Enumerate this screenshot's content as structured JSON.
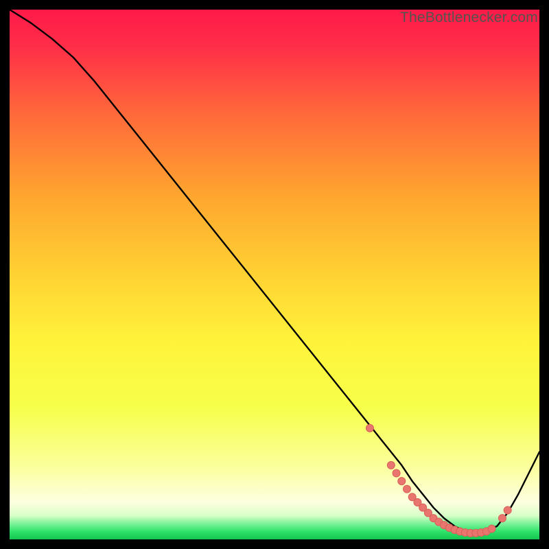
{
  "watermark": "TheBottlenecker.com",
  "colors": {
    "bg_black": "#000000",
    "line": "#000000",
    "dot_fill": "#e8766f",
    "dot_stroke": "#d85f58",
    "grad_top": "#ff1a49",
    "grad_mid_upper": "#ff8a2a",
    "grad_mid": "#ffde33",
    "grad_lower": "#f6ff4a",
    "grad_pale": "#fdffd8",
    "grad_green": "#2fe36a",
    "grad_green2": "#13c64f"
  },
  "chart_data": {
    "type": "line",
    "title": "",
    "xlabel": "",
    "ylabel": "",
    "xlim": [
      0,
      100
    ],
    "ylim": [
      0,
      100
    ],
    "series": [
      {
        "name": "bottleneck-curve",
        "x": [
          0,
          4,
          8,
          12,
          16,
          20,
          24,
          28,
          32,
          36,
          40,
          44,
          48,
          52,
          56,
          60,
          64,
          68,
          70,
          72,
          74,
          76,
          78,
          80,
          82,
          84,
          86,
          88,
          90,
          92,
          94,
          96,
          98,
          100
        ],
        "y": [
          100,
          97.5,
          94.5,
          91,
          86.5,
          81.5,
          76.5,
          71.5,
          66.5,
          61.5,
          56.5,
          51.5,
          46.5,
          41.5,
          36.5,
          31.5,
          26.5,
          21.5,
          19,
          16.5,
          14,
          11,
          8.5,
          6,
          4,
          2.5,
          1.5,
          1.2,
          1.5,
          2.5,
          5,
          8.5,
          12.5,
          16.5
        ]
      }
    ],
    "flat_region_dots": {
      "x": [
        68,
        72,
        73,
        74,
        75,
        76,
        77,
        78,
        79,
        80,
        81,
        82,
        83,
        84,
        85,
        86,
        87,
        88,
        89,
        90,
        91,
        93,
        94
      ],
      "y": [
        21,
        14,
        12.5,
        11,
        9.5,
        8,
        7,
        6,
        5,
        4,
        3.3,
        2.7,
        2.2,
        1.8,
        1.5,
        1.3,
        1.2,
        1.2,
        1.3,
        1.5,
        2.0,
        4.0,
        5.5
      ]
    }
  }
}
